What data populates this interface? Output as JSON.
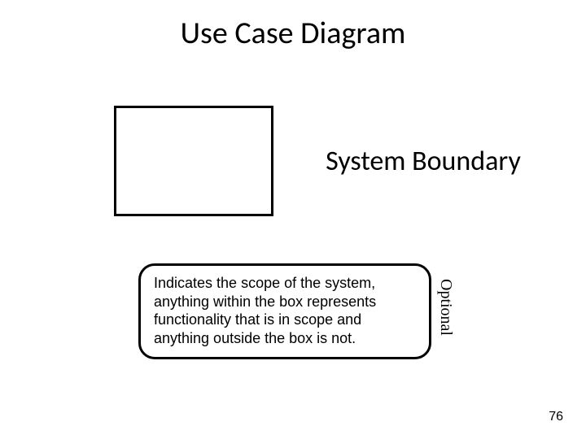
{
  "title": "Use Case Diagram",
  "subtitle": "System Boundary",
  "note": "Indicates the scope of the system, anything within the box represents functionality that is in scope and anything outside the box is not.",
  "optional_label": "Optional",
  "page_number": "76"
}
